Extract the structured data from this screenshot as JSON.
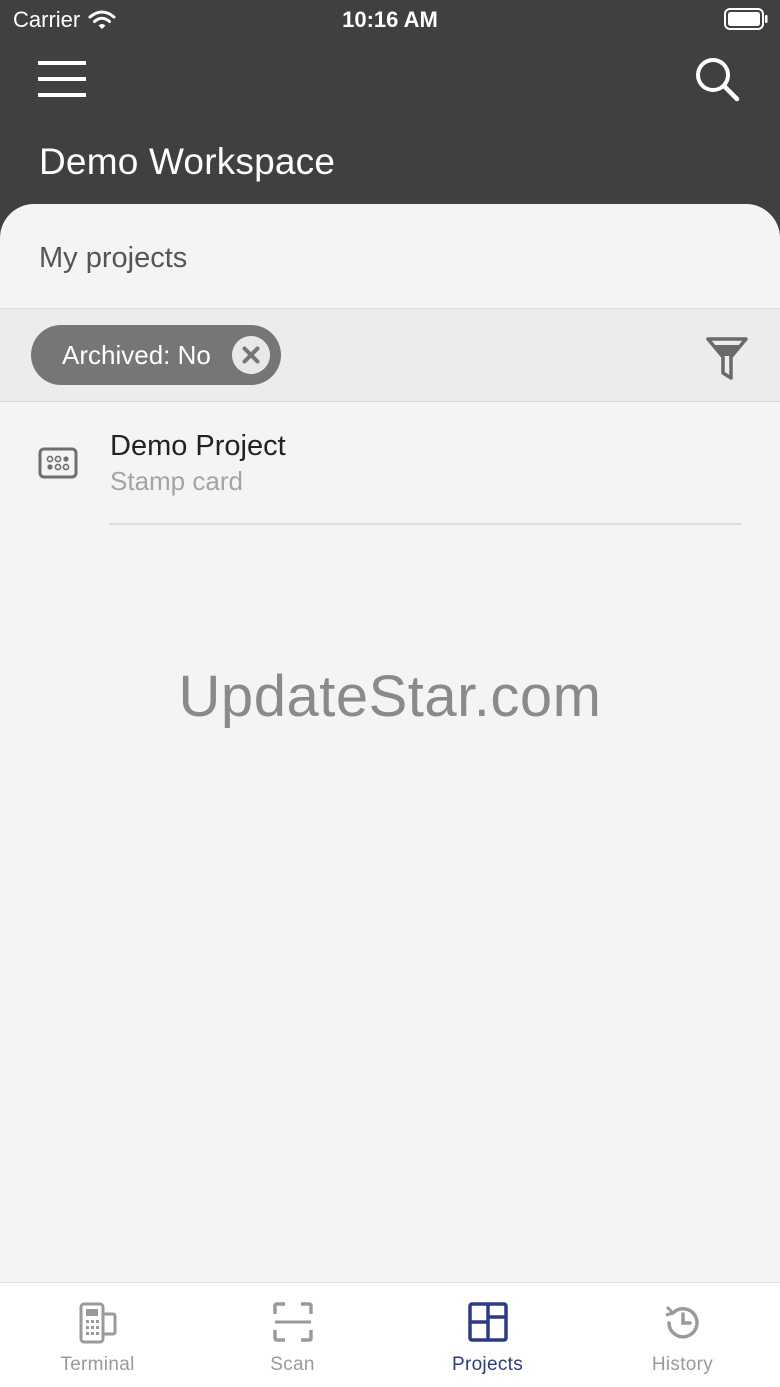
{
  "status_bar": {
    "carrier": "Carrier",
    "time": "10:16 AM"
  },
  "header": {
    "title": "Demo Workspace",
    "menu_icon": "hamburger-menu-icon",
    "search_icon": "search-icon"
  },
  "section": {
    "title": "My projects"
  },
  "filter": {
    "chip_label": "Archived: No",
    "chip_close_icon": "close-icon",
    "filter_icon": "funnel-icon"
  },
  "projects": [
    {
      "title": "Demo Project",
      "subtitle": "Stamp card",
      "icon": "stamp-card-icon"
    }
  ],
  "watermark": "UpdateStar.com",
  "tabs": [
    {
      "label": "Terminal",
      "icon": "terminal-icon",
      "active": false
    },
    {
      "label": "Scan",
      "icon": "scan-icon",
      "active": false
    },
    {
      "label": "Projects",
      "icon": "projects-icon",
      "active": true
    },
    {
      "label": "History",
      "icon": "history-icon",
      "active": false
    }
  ],
  "colors": {
    "header_bg": "#404040",
    "accent": "#2a3a8e",
    "chip_bg": "#767676",
    "sheet_bg": "#f4f4f4"
  }
}
